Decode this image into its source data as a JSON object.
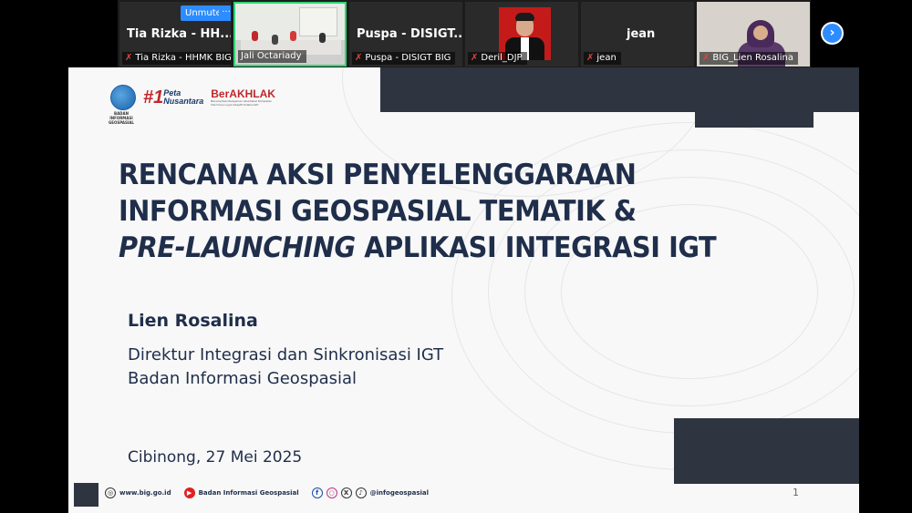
{
  "participants": [
    {
      "display_name": "Tia Rizka - HH...",
      "tag": "Tia Rizka - HHMK BIG",
      "muted": true
    },
    {
      "display_name": "",
      "tag": "Jali Octariady",
      "muted": false,
      "active_speaker": true
    },
    {
      "display_name": "Puspa - DISIGT...",
      "tag": "Puspa - DISIGT BIG",
      "muted": true
    },
    {
      "display_name": "",
      "tag": "Deril_DJP",
      "muted": true
    },
    {
      "display_name": "jean",
      "tag": "jean",
      "muted": true
    },
    {
      "display_name": "",
      "tag": "BIG_Lien Rosalina",
      "muted": true
    }
  ],
  "controls": {
    "unmute_label": "Unmute",
    "more_label": "···",
    "next_label": "›"
  },
  "icons": {
    "mic": "mic-muted-icon",
    "next": "chevron-right-icon"
  },
  "colors": {
    "accent": "#2d8cff",
    "active_border": "#2ed573",
    "slide_dark": "#2e3440",
    "title": "#1f2e4a",
    "brand_red": "#c0282d"
  },
  "slide": {
    "logo_caption": "BADAN INFORMASI GEOSPASIAL",
    "peta_number": "#1",
    "peta_line1": "Peta",
    "peta_line2": "Nusantara",
    "berakhlak": "BerAKHLAK",
    "berakhlak_sub": "Berorientasi Pelayanan Akuntabel Kompeten Harmonis Loyal Adaptif Kolaboratif",
    "title_line1": "RENCANA AKSI PENYELENGGARAAN",
    "title_line2": "INFORMASI GEOSPASIAL TEMATIK &",
    "title_line3_italic": "PRE-LAUNCHING",
    "title_line3_rest": " APLIKASI INTEGRASI IGT",
    "speaker": "Lien Rosalina",
    "role_line1": "Direktur Integrasi dan Sinkronisasi IGT",
    "role_line2": "Badan Informasi Geospasial",
    "date": "Cibinong, 27 Mei 2025",
    "footer_web": "www.big.go.id",
    "footer_youtube": "Badan Informasi Geospasial",
    "footer_social": "@infogeospasial",
    "page_number": "1"
  }
}
